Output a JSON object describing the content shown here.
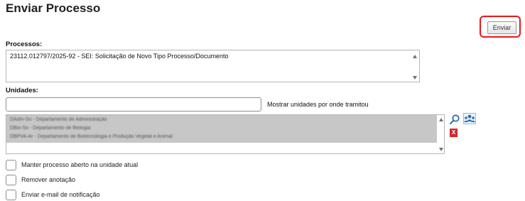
{
  "page": {
    "title": "Enviar Processo"
  },
  "toolbar": {
    "send_label": "Enviar"
  },
  "processos": {
    "label": "Processos:",
    "items": [
      "23112.012797/2025-92 - SEI: Solicitação de Novo Tipo Processo/Documento"
    ]
  },
  "unidades": {
    "label": "Unidades:",
    "input_value": "",
    "show_units_label": "Mostrar unidades por onde tramitou",
    "items": [
      "DAdm-So - Departamento de Administração",
      "DBio-So - Departamento de Biologia",
      "DBPVA-Ar - Departamento de Biotecnologia e Produção Vegetal e Animal"
    ],
    "icons": {
      "search": "search-icon",
      "group": "group-icon",
      "remove": "remove-icon"
    },
    "remove_glyph": "X"
  },
  "options": [
    {
      "label": "Manter processo aberto na unidade atual",
      "checked": false
    },
    {
      "label": "Remover anotação",
      "checked": false
    },
    {
      "label": "Enviar e-mail de notificação",
      "checked": false
    }
  ],
  "colors": {
    "highlight": "#e81818",
    "selection": "#c7c7c7",
    "remove": "#d6262b",
    "icon_blue": "#2d6fb2"
  }
}
